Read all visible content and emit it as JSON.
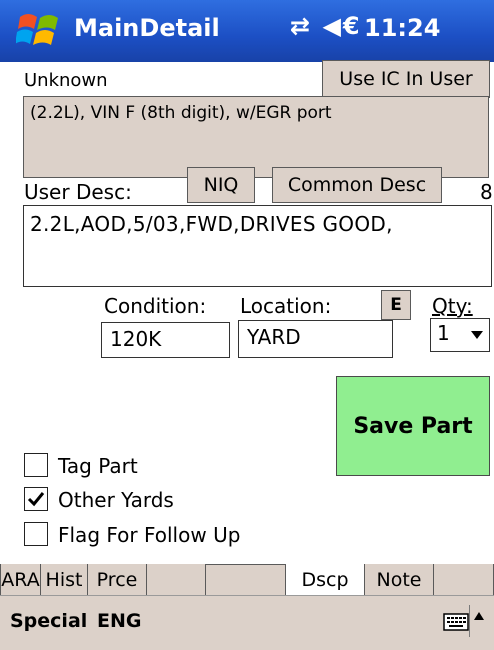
{
  "titlebar": {
    "title": "MainDetail",
    "status_icons": "⇄ ◀€",
    "clock": "11:24"
  },
  "interchange": {
    "label": "Unknown",
    "use_ic_button": "Use IC In User",
    "description": "(2.2L), VIN F (8th digit), w/EGR port"
  },
  "user_desc": {
    "label": "User Desc:",
    "niq_button": "NIQ",
    "common_desc_button": "Common Desc",
    "counter": "8",
    "value": "2.2L,AOD,5/03,FWD,DRIVES GOOD,"
  },
  "fields": {
    "condition_label": "Condition:",
    "condition_value": "120K",
    "location_label": "Location:",
    "location_value": "YARD",
    "e_button": "E",
    "qty_label": "Qty:",
    "qty_value": "1"
  },
  "save_button": "Save Part",
  "checkboxes": [
    {
      "label": "Tag Part",
      "checked": false
    },
    {
      "label": "Other Yards",
      "checked": true
    },
    {
      "label": "Flag For Follow Up",
      "checked": false
    }
  ],
  "tabs": [
    "ARA",
    "Hist",
    "Prce",
    "",
    "Dscp",
    "Note",
    ""
  ],
  "active_tab": "Dscp",
  "menubar": {
    "left": "Special",
    "right": "ENG"
  },
  "colors": {
    "titlebar": "#1c4fc4",
    "button_face": "#dcd1c9",
    "save_green": "#90ee90"
  },
  "icons": [
    "windows-logo-icon",
    "connectivity-icon",
    "speaker-icon",
    "keyboard-icon",
    "up-arrow-icon"
  ]
}
